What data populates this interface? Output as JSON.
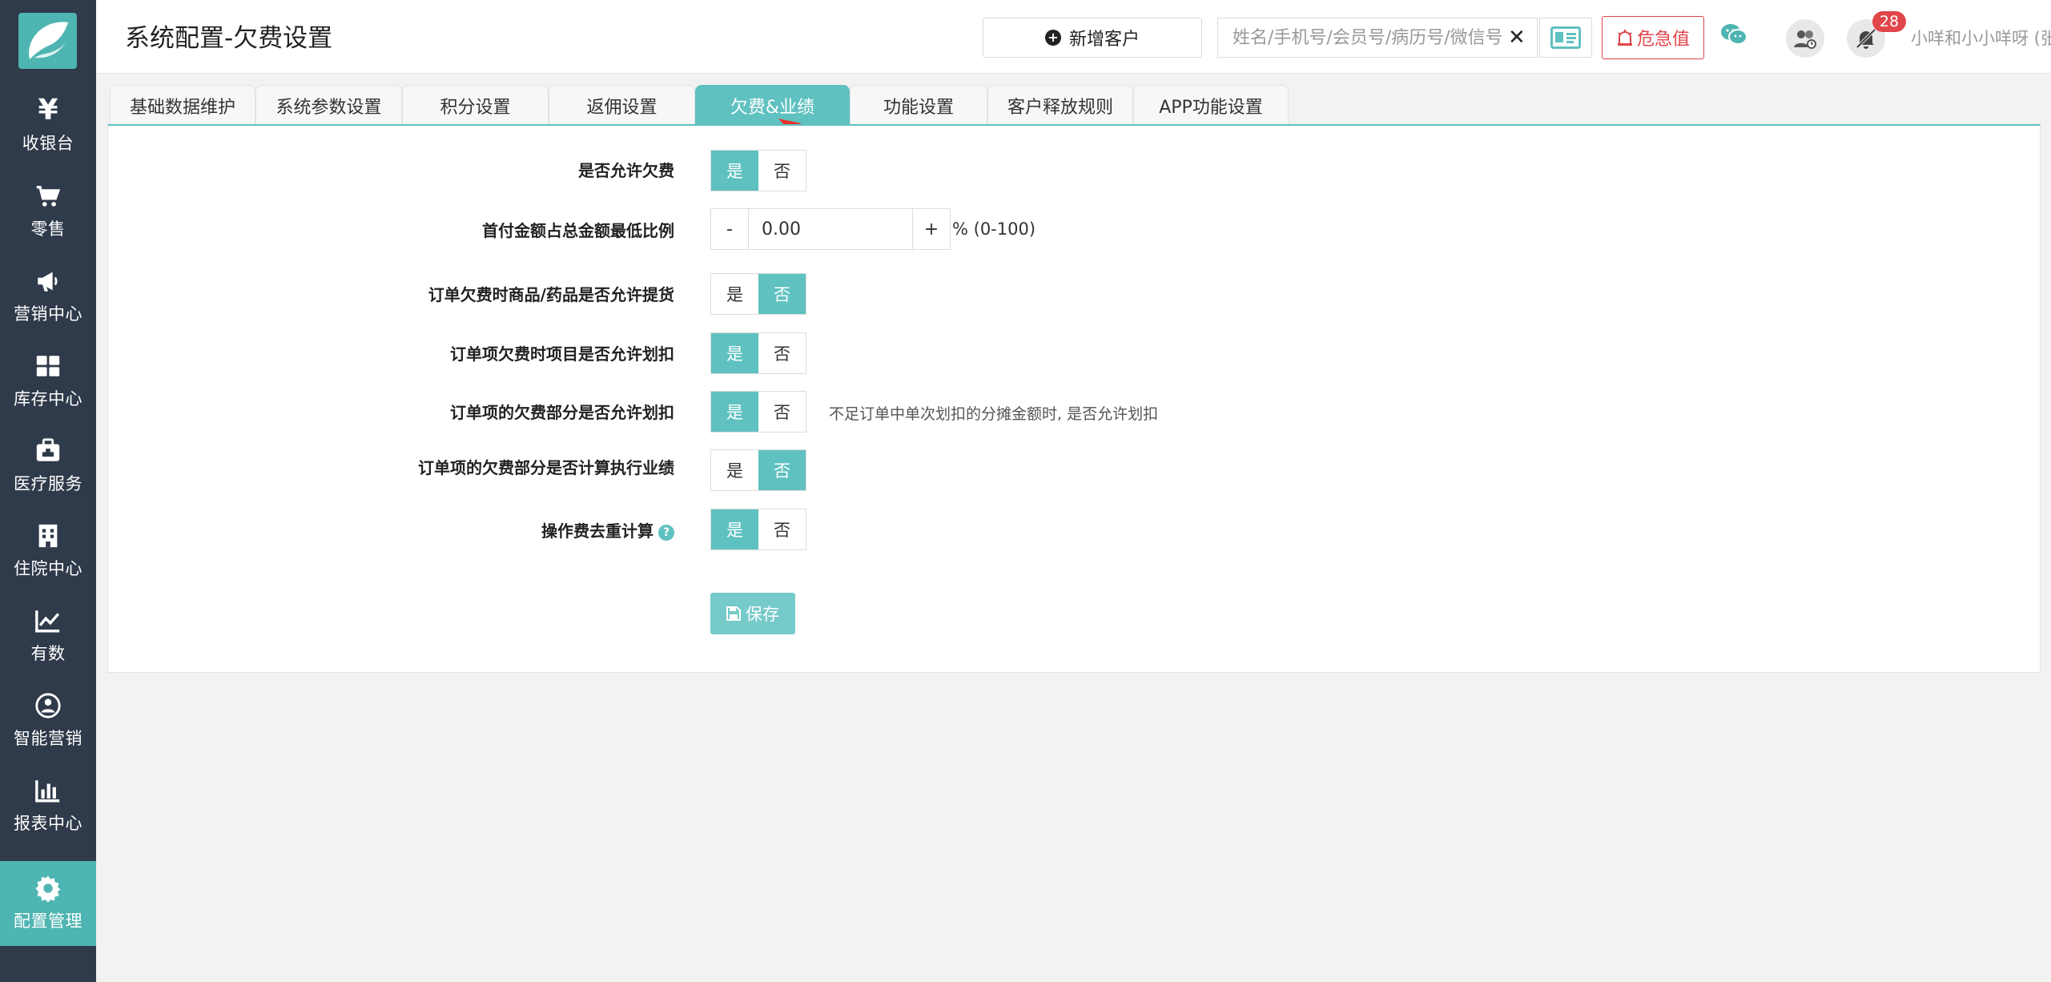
{
  "sidebar": {
    "items": [
      {
        "label": "收银台",
        "icon": "yen-icon"
      },
      {
        "label": "零售",
        "icon": "cart-icon"
      },
      {
        "label": "营销中心",
        "icon": "megaphone-icon"
      },
      {
        "label": "库存中心",
        "icon": "grid-icon"
      },
      {
        "label": "医疗服务",
        "icon": "medkit-icon"
      },
      {
        "label": "住院中心",
        "icon": "hospital-icon"
      },
      {
        "label": "有数",
        "icon": "line-chart-icon"
      },
      {
        "label": "智能营销",
        "icon": "smart-marketing-icon"
      },
      {
        "label": "报表中心",
        "icon": "bar-chart-icon"
      },
      {
        "label": "配置管理",
        "icon": "gear-icon",
        "active": true
      }
    ]
  },
  "header": {
    "title": "系统配置-欠费设置",
    "new_customer_label": "新增客户",
    "search_placeholder": "姓名/手机号/会员号/病历号/微信号",
    "danger_label": "危急值",
    "notification_count": "28",
    "user_label": "小咩和小小咩呀 (张江门诊部)"
  },
  "tabs": [
    {
      "label": "基础数据维护"
    },
    {
      "label": "系统参数设置"
    },
    {
      "label": "积分设置"
    },
    {
      "label": "返佣设置"
    },
    {
      "label": "欠费&业绩",
      "active": true
    },
    {
      "label": "功能设置"
    },
    {
      "label": "客户释放规则"
    },
    {
      "label": "APP功能设置"
    }
  ],
  "form": {
    "yes_label": "是",
    "no_label": "否",
    "rows": [
      {
        "label": "是否允许欠费",
        "value": "是"
      },
      {
        "label": "首付金额占总金额最低比例",
        "value": "0.00",
        "unit": "% (0-100)",
        "minus": "-",
        "plus": "+"
      },
      {
        "label": "订单欠费时商品/药品是否允许提货",
        "value": "否"
      },
      {
        "label": "订单项欠费时项目是否允许划扣",
        "value": "是"
      },
      {
        "label": "订单项的欠费部分是否允许划扣",
        "value": "是",
        "hint": "不足订单中单次划扣的分摊金额时, 是否允许划扣"
      },
      {
        "label": "订单项的欠费部分是否计算执行业绩",
        "value": "否"
      },
      {
        "label": "操作费去重计算",
        "value": "是"
      }
    ],
    "save_label": "保存"
  },
  "colors": {
    "accent": "#5fc1c0",
    "sidebar_bg": "#2f3a4a",
    "danger": "#e0454a"
  }
}
